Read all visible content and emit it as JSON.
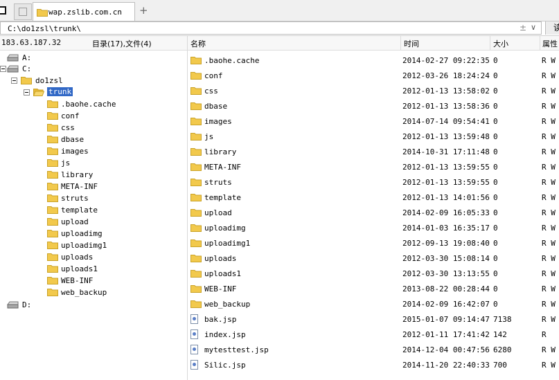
{
  "tabs": [
    {
      "label": ""
    },
    {
      "label": "wap.zslib.com.cn"
    }
  ],
  "add_tab_label": "+",
  "address": {
    "value": "C:\\do1zsl\\trunk\\",
    "split_glyph": "±",
    "dropdown_glyph": "∨",
    "go_label": "读"
  },
  "info": {
    "host": "183.63.187.32",
    "counts": "目录(17),文件(4)"
  },
  "columns": {
    "name": "名称",
    "time": "时间",
    "size": "大小",
    "attr": "属性"
  },
  "tree": {
    "drives": [
      {
        "label": "A:"
      },
      {
        "label": "C:"
      },
      {
        "label": "D:"
      }
    ],
    "root_folder": "do1zsl",
    "selected": "trunk",
    "children": [
      ".baohe.cache",
      "conf",
      "css",
      "dbase",
      "images",
      "js",
      "library",
      "META-INF",
      "struts",
      "template",
      "upload",
      "uploadimg",
      "uploadimg1",
      "uploads",
      "uploads1",
      "WEB-INF",
      "web_backup"
    ]
  },
  "files": [
    {
      "name": ".baohe.cache",
      "time": "2014-02-27 09:22:35",
      "size": "0",
      "attr": "R W",
      "type": "folder"
    },
    {
      "name": "conf",
      "time": "2012-03-26 18:24:24",
      "size": "0",
      "attr": "R W",
      "type": "folder"
    },
    {
      "name": "css",
      "time": "2012-01-13 13:58:02",
      "size": "0",
      "attr": "R W",
      "type": "folder"
    },
    {
      "name": "dbase",
      "time": "2012-01-13 13:58:36",
      "size": "0",
      "attr": "R W",
      "type": "folder"
    },
    {
      "name": "images",
      "time": "2014-07-14 09:54:41",
      "size": "0",
      "attr": "R W",
      "type": "folder"
    },
    {
      "name": "js",
      "time": "2012-01-13 13:59:48",
      "size": "0",
      "attr": "R W",
      "type": "folder"
    },
    {
      "name": "library",
      "time": "2014-10-31 17:11:48",
      "size": "0",
      "attr": "R W",
      "type": "folder"
    },
    {
      "name": "META-INF",
      "time": "2012-01-13 13:59:55",
      "size": "0",
      "attr": "R W",
      "type": "folder"
    },
    {
      "name": "struts",
      "time": "2012-01-13 13:59:55",
      "size": "0",
      "attr": "R W",
      "type": "folder"
    },
    {
      "name": "template",
      "time": "2012-01-13 14:01:56",
      "size": "0",
      "attr": "R W",
      "type": "folder"
    },
    {
      "name": "upload",
      "time": "2014-02-09 16:05:33",
      "size": "0",
      "attr": "R W",
      "type": "folder"
    },
    {
      "name": "uploadimg",
      "time": "2014-01-03 16:35:17",
      "size": "0",
      "attr": "R W",
      "type": "folder"
    },
    {
      "name": "uploadimg1",
      "time": "2012-09-13 19:08:40",
      "size": "0",
      "attr": "R W",
      "type": "folder"
    },
    {
      "name": "uploads",
      "time": "2012-03-30 15:08:14",
      "size": "0",
      "attr": "R W",
      "type": "folder"
    },
    {
      "name": "uploads1",
      "time": "2012-03-30 13:13:55",
      "size": "0",
      "attr": "R W",
      "type": "folder"
    },
    {
      "name": "WEB-INF",
      "time": "2013-08-22 00:28:44",
      "size": "0",
      "attr": "R W",
      "type": "folder"
    },
    {
      "name": "web_backup",
      "time": "2014-02-09 16:42:07",
      "size": "0",
      "attr": "R W",
      "type": "folder"
    },
    {
      "name": "bak.jsp",
      "time": "2015-01-07 09:14:47",
      "size": "7138",
      "attr": "R W",
      "type": "jsp-file"
    },
    {
      "name": "index.jsp",
      "time": "2012-01-11 17:41:42",
      "size": "142",
      "attr": "R",
      "type": "jsp-file"
    },
    {
      "name": "mytesttest.jsp",
      "time": "2014-12-04 00:47:56",
      "size": "6280",
      "attr": "R W",
      "type": "jsp-file"
    },
    {
      "name": "Silic.jsp",
      "time": "2014-11-20 22:40:33",
      "size": "700",
      "attr": "R W",
      "type": "jsp-file"
    }
  ],
  "colors": {
    "folder": "#f2c94c",
    "folder_edge": "#c9a227",
    "selection": "#3168c6"
  }
}
